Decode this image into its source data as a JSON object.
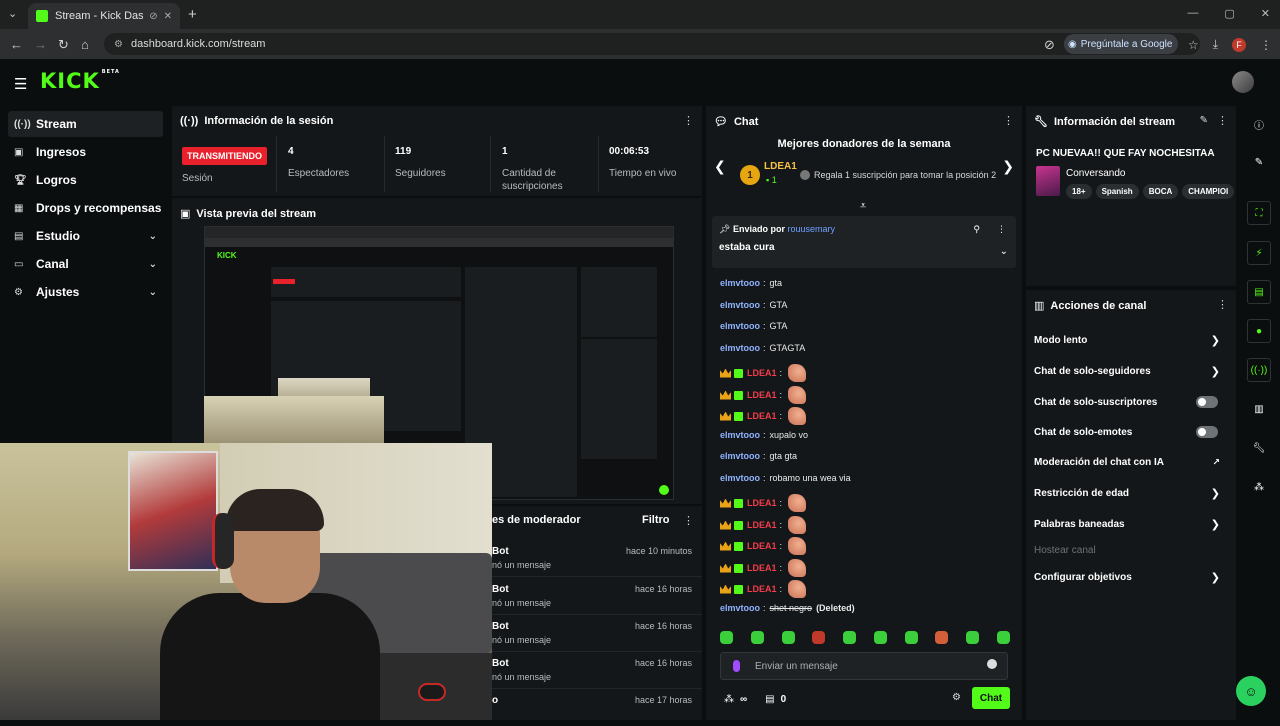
{
  "browser": {
    "tab_title": "Stream - Kick Dashboard",
    "url": "dashboard.kick.com/stream",
    "ask_google": "Pregúntale a Google",
    "profile_initial": "F"
  },
  "header": {
    "logo": "KICK",
    "logo_badge": "BETA"
  },
  "sidebar": {
    "items": [
      {
        "label": "Stream",
        "icon": "stream-icon",
        "active": true
      },
      {
        "label": "Ingresos",
        "icon": "revenue-icon"
      },
      {
        "label": "Logros",
        "icon": "trophy-icon"
      },
      {
        "label": "Drops y recompensas",
        "icon": "gift-icon"
      },
      {
        "label": "Estudio",
        "icon": "studio-icon",
        "expandable": true
      },
      {
        "label": "Canal",
        "icon": "channel-icon",
        "expandable": true
      },
      {
        "label": "Ajustes",
        "icon": "gear-icon",
        "expandable": true
      }
    ]
  },
  "session": {
    "title": "Información de la sesión",
    "live_badge": "TRANSMITIENDO",
    "session_label": "Sesión",
    "stats": [
      {
        "value": "4",
        "label": "Espectadores"
      },
      {
        "value": "119",
        "label": "Seguidores"
      },
      {
        "value": "1",
        "label": "Cantidad de suscripciones"
      },
      {
        "value": "00:06:53",
        "label": "Tiempo en vivo"
      }
    ]
  },
  "preview": {
    "title": "Vista previa del stream"
  },
  "mod_actions": {
    "title_partial": "es de moderador",
    "filter_label": "Filtro",
    "rows": [
      {
        "name": "Bot",
        "msg": "nó un mensaje",
        "time": "hace 10 minutos"
      },
      {
        "name": "Bot",
        "msg": "nó un mensaje",
        "time": "hace 16 horas"
      },
      {
        "name": "Bot",
        "msg": "nó un mensaje",
        "time": "hace 16 horas"
      },
      {
        "name": "Bot",
        "msg": "nó un mensaje",
        "time": "hace 16 horas"
      },
      {
        "name": "o",
        "msg": "",
        "time": "hace 17 horas"
      }
    ]
  },
  "chat": {
    "title": "Chat",
    "top_donors_title": "Mejores donadores de la semana",
    "donor": {
      "rank": "1",
      "name": "LDEA1",
      "subs": "1",
      "gift_text": "Regala 1 suscripción para tomar la posición 2"
    },
    "pinned": {
      "sent_by_label": "Enviado por",
      "sender": "rouusemary",
      "message": "estaba cura"
    },
    "messages": [
      {
        "user": "elmvtooo",
        "text": "gta"
      },
      {
        "user": "elmvtooo",
        "text": "GTA"
      },
      {
        "user": "elmvtooo",
        "text": "GTA"
      },
      {
        "user": "elmvtooo",
        "text": "GTAGTA"
      },
      {
        "user": "LDEA1",
        "text": "",
        "badges": true,
        "emote": true
      },
      {
        "user": "LDEA1",
        "text": "",
        "badges": true,
        "emote": true
      },
      {
        "user": "LDEA1",
        "text": "",
        "badges": true,
        "emote": true
      },
      {
        "user": "elmvtooo",
        "text": "xupalo vo"
      },
      {
        "user": "elmvtooo",
        "text": "gta gta"
      },
      {
        "user": "elmvtooo",
        "text": "robamo una wea via"
      },
      {
        "user": "LDEA1",
        "text": "",
        "badges": true,
        "emote": true
      },
      {
        "user": "LDEA1",
        "text": "",
        "badges": true,
        "emote": true
      },
      {
        "user": "LDEA1",
        "text": "",
        "badges": true,
        "emote": true
      },
      {
        "user": "LDEA1",
        "text": "",
        "badges": true,
        "emote": true
      },
      {
        "user": "LDEA1",
        "text": "",
        "badges": true,
        "emote": true
      },
      {
        "user": "elmvtooo",
        "text": "shet negro",
        "deleted": "(Deleted)"
      }
    ],
    "input_placeholder": "Enviar un mensaje",
    "points_value": "∞",
    "kicks_value": "0",
    "send_label": "Chat"
  },
  "stream_info": {
    "title": "Información del stream",
    "stream_title": "PC NUEVAA!! QUE FAY NOCHESITAA",
    "category": "Conversando",
    "tags": [
      "18+",
      "Spanish",
      "BOCA",
      "CHAMPIOI"
    ]
  },
  "channel_actions": {
    "title": "Acciones de canal",
    "rows": [
      {
        "label": "Modo lento",
        "control": "arrow"
      },
      {
        "label": "Chat de solo-seguidores",
        "control": "arrow"
      },
      {
        "label": "Chat de solo-suscriptores",
        "control": "toggle"
      },
      {
        "label": "Chat de solo-emotes",
        "control": "toggle"
      },
      {
        "label": "Moderación del chat con IA",
        "control": "external"
      },
      {
        "label": "Restricción de edad",
        "control": "arrow"
      },
      {
        "label": "Palabras baneadas",
        "control": "arrow"
      },
      {
        "label": "Hostear canal",
        "control": "none",
        "disabled": true
      },
      {
        "label": "Configurar objetivos",
        "control": "arrow"
      }
    ]
  },
  "colors": {
    "brand": "#53fc18",
    "live": "#e8212d",
    "panel": "#141719",
    "background": "#0b0e0f"
  }
}
